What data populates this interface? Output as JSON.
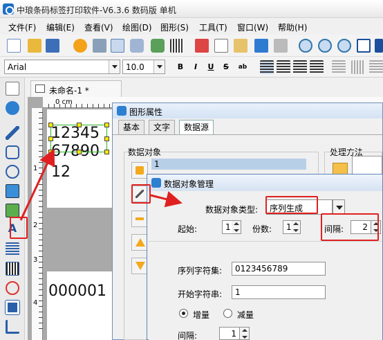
{
  "app": {
    "title": "中琅条码标签打印软件-V6.3.6 数码版 单机"
  },
  "menu": [
    "文件(F)",
    "编辑(E)",
    "查看(V)",
    "绘图(D)",
    "图形(S)",
    "工具(T)",
    "窗口(W)",
    "帮助(H)"
  ],
  "format": {
    "font": "Arial",
    "size": "10.0",
    "bold": "B",
    "italic": "I",
    "underline": "U",
    "strike": "S"
  },
  "document": {
    "tab": "未命名-1 *",
    "ruler_unit": "0 cm",
    "ruler_marks": [
      "1",
      "2",
      "3",
      "4"
    ],
    "text_lines": [
      "12345",
      "67890",
      "12"
    ],
    "preview_value": "000001"
  },
  "dialog1": {
    "title": "图形属性",
    "tabs": [
      "基本",
      "文字",
      "数据源"
    ],
    "group_data": "数据对象",
    "group_process": "处理方法",
    "list_first": "1"
  },
  "dialog2": {
    "title": "数据对象管理",
    "type_label": "数据对象类型:",
    "type_value": "序列生成",
    "start_label": "起始:",
    "start_value": "1",
    "copies_label": "份数:",
    "copies_value": "1",
    "interval_label": "间隔:",
    "interval_value": "2",
    "charset_label": "序列字符集:",
    "charset_value": "0123456789",
    "startstr_label": "开始字符串:",
    "startstr_value": "1",
    "increase_label": "增量",
    "decrease_label": "减量",
    "step_label": "间隔:",
    "step_value": "1"
  },
  "colors": {
    "annotation": "#e02020",
    "selection": "#2bb52b",
    "handle": "#ffe600"
  }
}
